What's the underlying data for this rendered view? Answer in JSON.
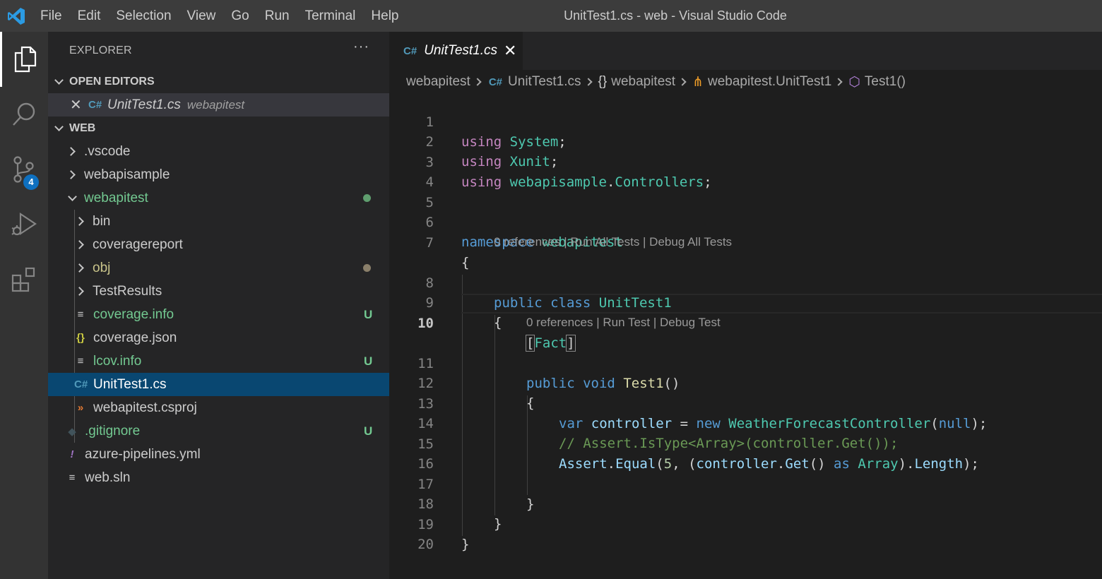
{
  "window": {
    "title": "UnitTest1.cs - web - Visual Studio Code",
    "menu": [
      "File",
      "Edit",
      "Selection",
      "View",
      "Go",
      "Run",
      "Terminal",
      "Help"
    ]
  },
  "activitybar": {
    "items": [
      "explorer-icon",
      "search-icon",
      "source-control-icon",
      "run-debug-icon",
      "extensions-icon"
    ],
    "source_control_badge": "4"
  },
  "sidebar": {
    "title": "EXPLORER",
    "more": "···",
    "open_editors": {
      "header": "OPEN EDITORS",
      "items": [
        {
          "name": "UnitTest1.cs",
          "folder": "webapitest"
        }
      ]
    },
    "workspace": {
      "header": "WEB",
      "items": [
        {
          "label": ".vscode"
        },
        {
          "label": "webapisample"
        },
        {
          "label": "webapitest"
        },
        {
          "label": "bin"
        },
        {
          "label": "coveragereport"
        },
        {
          "label": "obj"
        },
        {
          "label": "TestResults"
        },
        {
          "label": "coverage.info",
          "decoration": "U"
        },
        {
          "label": "coverage.json"
        },
        {
          "label": "lcov.info",
          "decoration": "U"
        },
        {
          "label": "UnitTest1.cs"
        },
        {
          "label": "webapitest.csproj"
        },
        {
          "label": ".gitignore",
          "decoration": "U"
        },
        {
          "label": "azure-pipelines.yml"
        },
        {
          "label": "web.sln"
        }
      ]
    }
  },
  "editor": {
    "tab": {
      "label": "UnitTest1.cs"
    },
    "breadcrumb": [
      "webapitest",
      "UnitTest1.cs",
      "webapitest",
      "webapitest.UnitTest1",
      "Test1()"
    ],
    "line_numbers": [
      "1",
      "2",
      "3",
      "4",
      "5",
      "6",
      "7",
      "8",
      "9",
      "10",
      "11",
      "12",
      "13",
      "14",
      "15",
      "16",
      "17",
      "18",
      "19",
      "20"
    ],
    "code_lens": {
      "class": "0 references | Run All Tests | Debug All Tests",
      "method": "0 references | Run Test | Debug Test"
    },
    "code": {
      "l1_kw": "using",
      "l1_ns": "System",
      "l1_end": ";",
      "l2_kw": "using",
      "l2_ns": "Xunit",
      "l2_end": ";",
      "l3_kw": "using",
      "l3_ns1": "webapisample",
      "l3_dot": ".",
      "l3_ns2": "Controllers",
      "l3_end": ";",
      "l6_kw": "namespace",
      "l6_name": "webapitest",
      "l7": "{",
      "l8_kw1": "public",
      "l8_kw2": "class",
      "l8_name": "UnitTest1",
      "l9": "{",
      "l10_open": "[",
      "l10_attr": "Fact",
      "l10_close": "]",
      "l11_kw1": "public",
      "l11_kw2": "void",
      "l11_fn": "Test1",
      "l11_end": "()",
      "l12": "{",
      "l13_kw": "var",
      "l13_var": "controller",
      "l13_eq": " = ",
      "l13_new": "new",
      "l13_type": "WeatherForecastController",
      "l13_open": "(",
      "l13_null": "null",
      "l13_end": ");",
      "l14": "// Assert.IsType<Array>(controller.Get());",
      "l15_cls": "Assert",
      "l15_dot": ".",
      "l15_fn": "Equal",
      "l15_open": "(",
      "l15_num": "5",
      "l15_comma": ", (",
      "l15_var": "controller",
      "l15_dot2": ".",
      "l15_get": "Get",
      "l15_paren": "() ",
      "l15_as": "as",
      "l15_type": "Array",
      "l15_close": ").",
      "l15_len": "Length",
      "l15_end": ");",
      "l17": "}",
      "l18": "}",
      "l19": "}"
    }
  }
}
